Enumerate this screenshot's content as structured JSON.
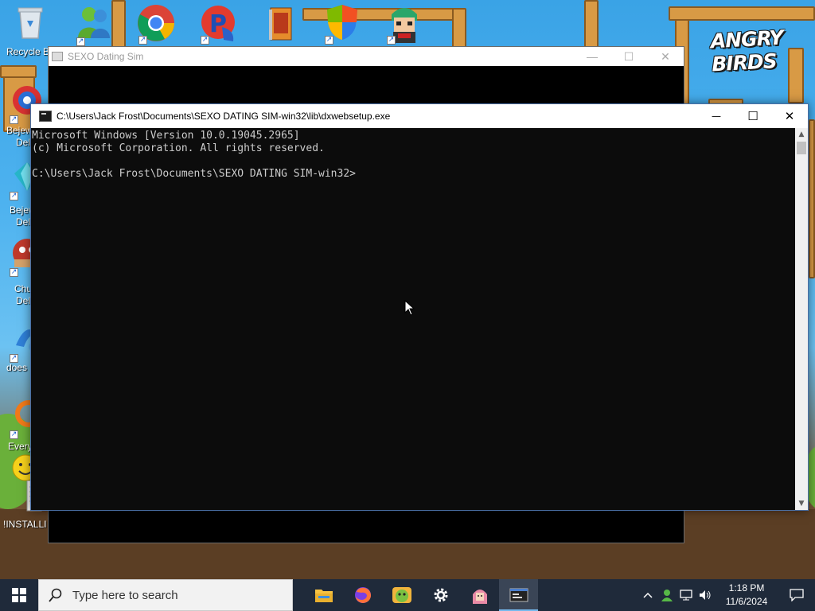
{
  "desktop": {
    "logo_text": "ANGRY BIRDS",
    "icons": [
      {
        "label": "Recycle B"
      },
      {
        "label": "Bejew"
      },
      {
        "label": "Del"
      },
      {
        "label": "Bejew"
      },
      {
        "label": "Del"
      },
      {
        "label": "Chu"
      },
      {
        "label": "Del"
      },
      {
        "label": "does"
      },
      {
        "label": "Every"
      },
      {
        "label": "!INSTALLI"
      }
    ]
  },
  "background_window": {
    "title": "SEXO Dating Sim",
    "minimize_glyph": "—",
    "maximize_glyph": "☐",
    "close_glyph": "✕"
  },
  "console_window": {
    "title": "C:\\Users\\Jack Frost\\Documents\\SEXO DATING SIM-win32\\lib\\dxwebsetup.exe",
    "minimize_glyph": "—",
    "maximize_glyph": "☐",
    "close_glyph": "✕",
    "lines": [
      "Microsoft Windows [Version 10.0.19045.2965]",
      "(c) Microsoft Corporation. All rights reserved.",
      "",
      "C:\\Users\\Jack Frost\\Documents\\SEXO DATING SIM-win32>"
    ]
  },
  "taskbar": {
    "search_placeholder": "Type here to search",
    "pinned_apps": [
      "file-explorer",
      "firefox",
      "game-app",
      "settings",
      "anime-game",
      "console"
    ],
    "clock": {
      "time": "1:18 PM",
      "date": "11/6/2024"
    },
    "accent_color": "#76b9ed"
  },
  "colors": {
    "console_bg": "#0c0c0c",
    "console_text": "#cccccc",
    "taskbar_bg": "#1f2a3a"
  }
}
